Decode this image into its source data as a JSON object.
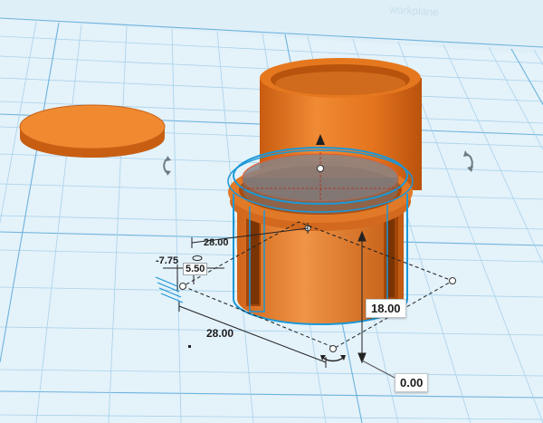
{
  "colors": {
    "plane": "#dfeff8",
    "grid_minor": "#a9d3ea",
    "grid_major": "#5aa9d6",
    "shape_orange": "#ea7a22",
    "shape_orange_dark": "#c75e12",
    "selection_blue": "#1a98d8",
    "hole_glass": "#8a7f80"
  },
  "icons": {
    "rotate_left": "rotate-arrow-icon",
    "rotate_right": "rotate-arrow-icon",
    "lift_cone": "lift-cone-icon"
  },
  "watermark": "workplane",
  "dimensions": {
    "width_top": "28.00",
    "offset_x": "-7.75",
    "offset_y": "5.50",
    "length_front": "28.00",
    "height": "18.00",
    "elevation": "0.00"
  }
}
